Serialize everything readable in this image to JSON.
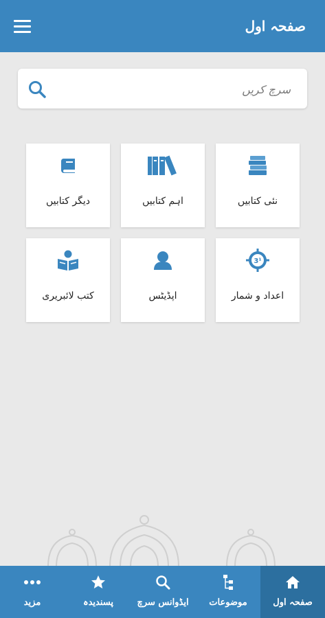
{
  "header": {
    "title": "صفحہ اول",
    "menu_icon": "menu-icon"
  },
  "search": {
    "placeholder": "سرچ کریں",
    "icon": "search-icon"
  },
  "tiles": [
    {
      "label": "نئی کتابیں",
      "icon": "books-stack-icon"
    },
    {
      "label": "اہم کتابیں",
      "icon": "bookshelf-icon"
    },
    {
      "label": "دیگر کتابیں",
      "icon": "book-icon"
    },
    {
      "label": "اعداد و شمار",
      "icon": "stats-badge-icon"
    },
    {
      "label": "اپڈیٹس",
      "icon": "user-icon"
    },
    {
      "label": "کتب لائبریری",
      "icon": "reader-icon"
    }
  ],
  "bottom_nav": [
    {
      "label": "صفحہ اول",
      "icon": "home-icon",
      "active": true
    },
    {
      "label": "موضوعات",
      "icon": "tree-icon",
      "active": false
    },
    {
      "label": "ایڈوانس سرچ",
      "icon": "search-icon",
      "active": false
    },
    {
      "label": "پسندیدہ",
      "icon": "star-icon",
      "active": false
    },
    {
      "label": "مزید",
      "icon": "more-icon",
      "active": false
    }
  ],
  "colors": {
    "primary": "#3a86bf",
    "active_tab": "#2c6f9f",
    "background": "#e9e9e9"
  }
}
